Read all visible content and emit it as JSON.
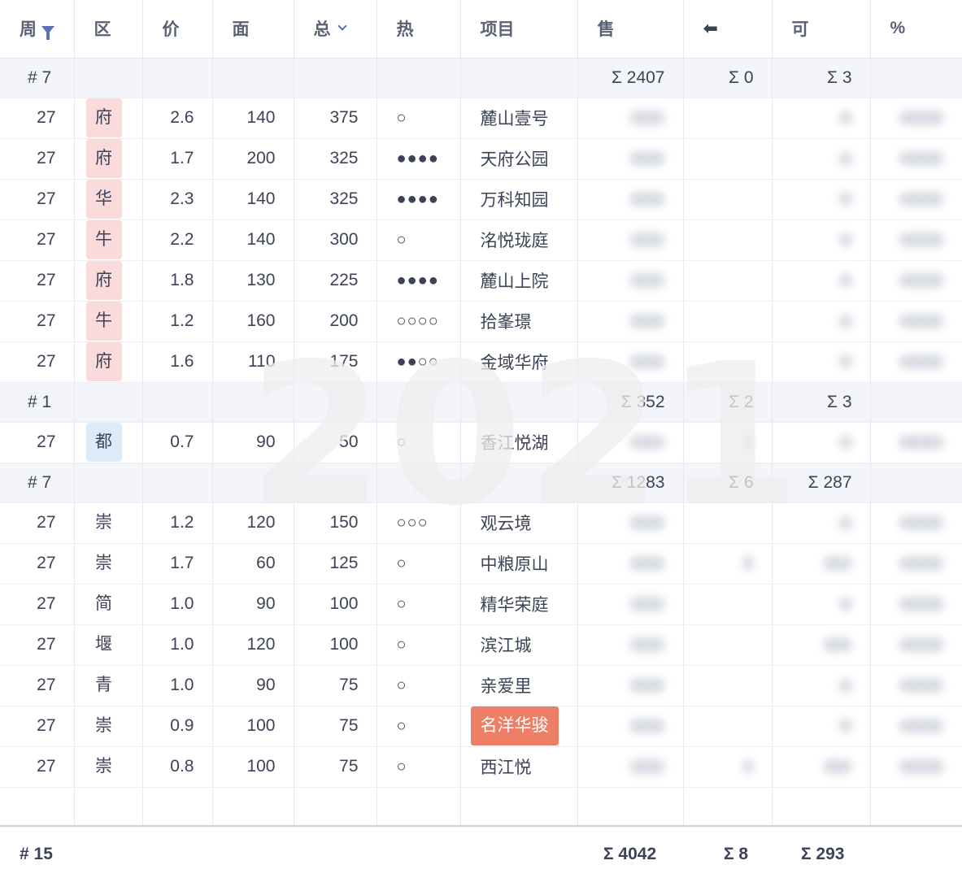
{
  "headers": {
    "week": "周",
    "district": "区",
    "price": "价",
    "area": "面",
    "total": "总",
    "heat": "热",
    "project": "项目",
    "sold": "售",
    "arrow_icon": "arrow-left-icon",
    "available": "可",
    "percent": "%"
  },
  "groups": [
    {
      "count": "# 7",
      "sum_sold": "Σ 2407",
      "sum_back": "Σ 0",
      "sum_avail": "Σ 3",
      "rows": [
        {
          "week": "27",
          "district": "府",
          "tag": "pink",
          "price": "2.6",
          "area": "140",
          "total": "375",
          "heat": "○",
          "project": "麓山壹号"
        },
        {
          "week": "27",
          "district": "府",
          "tag": "pink",
          "price": "1.7",
          "area": "200",
          "total": "325",
          "heat": "●●●●",
          "project": "天府公园"
        },
        {
          "week": "27",
          "district": "华",
          "tag": "pink",
          "price": "2.3",
          "area": "140",
          "total": "325",
          "heat": "●●●●",
          "project": "万科知园"
        },
        {
          "week": "27",
          "district": "牛",
          "tag": "pink",
          "price": "2.2",
          "area": "140",
          "total": "300",
          "heat": "○",
          "project": "洺悦珑庭"
        },
        {
          "week": "27",
          "district": "府",
          "tag": "pink",
          "price": "1.8",
          "area": "130",
          "total": "225",
          "heat": "●●●●",
          "project": "麓山上院"
        },
        {
          "week": "27",
          "district": "牛",
          "tag": "pink",
          "price": "1.2",
          "area": "160",
          "total": "200",
          "heat": "○○○○",
          "project": "拾峯璟"
        },
        {
          "week": "27",
          "district": "府",
          "tag": "pink",
          "price": "1.6",
          "area": "110",
          "total": "175",
          "heat": "●●○○",
          "project": "金域华府"
        }
      ]
    },
    {
      "count": "# 1",
      "sum_sold": "Σ 352",
      "sum_back": "Σ 2",
      "sum_avail": "Σ 3",
      "rows": [
        {
          "week": "27",
          "district": "都",
          "tag": "blue",
          "price": "0.7",
          "area": "90",
          "total": "50",
          "heat": "○",
          "project": "香江悦湖"
        }
      ]
    },
    {
      "count": "# 7",
      "sum_sold": "Σ 1283",
      "sum_back": "Σ 6",
      "sum_avail": "Σ 287",
      "rows": [
        {
          "week": "27",
          "district": "崇",
          "tag": "plain",
          "price": "1.2",
          "area": "120",
          "total": "150",
          "heat": "○○○",
          "project": "观云境"
        },
        {
          "week": "27",
          "district": "崇",
          "tag": "plain",
          "price": "1.7",
          "area": "60",
          "total": "125",
          "heat": "○",
          "project": "中粮原山"
        },
        {
          "week": "27",
          "district": "简",
          "tag": "plain",
          "price": "1.0",
          "area": "90",
          "total": "100",
          "heat": "○",
          "project": "精华荣庭"
        },
        {
          "week": "27",
          "district": "堰",
          "tag": "plain",
          "price": "1.0",
          "area": "120",
          "total": "100",
          "heat": "○",
          "project": "滨江城"
        },
        {
          "week": "27",
          "district": "青",
          "tag": "plain",
          "price": "1.0",
          "area": "90",
          "total": "75",
          "heat": "○",
          "project": "亲爱里"
        },
        {
          "week": "27",
          "district": "崇",
          "tag": "plain",
          "price": "0.9",
          "area": "100",
          "total": "75",
          "heat": "○",
          "project": "名洋华骏",
          "highlight": true
        },
        {
          "week": "27",
          "district": "崇",
          "tag": "plain",
          "price": "0.8",
          "area": "100",
          "total": "75",
          "heat": "○",
          "project": "西江悦"
        }
      ]
    }
  ],
  "footer": {
    "count": "# 15",
    "sum_sold": "Σ 4042",
    "sum_back": "Σ 8",
    "sum_avail": "Σ 293"
  },
  "watermark": "2021",
  "colors": {
    "tag_pink": "#fadadb",
    "tag_blue": "#dcebf8",
    "highlight": "#ec7f66",
    "group_bg": "#f3f5fa",
    "icon_accent": "#5b6fb5"
  }
}
